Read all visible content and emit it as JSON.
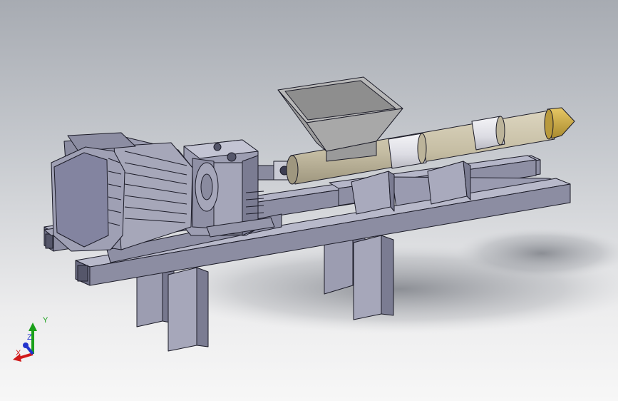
{
  "triad": {
    "x_label": "X",
    "y_label": "Y",
    "z_label": "Z",
    "colors": {
      "x": "#d11a1a",
      "y": "#1aa01a",
      "z": "#2233cc"
    }
  },
  "colors": {
    "steel": "#9a9bb0",
    "steel_light": "#b3b4c6",
    "steel_dark": "#6e6f86",
    "outline": "#1c1c28",
    "barrel": "#cbc3aa",
    "barrel_band": "#e4e4ea",
    "nozzle": "#d0ae45",
    "hopper": "#a6a6a6"
  }
}
